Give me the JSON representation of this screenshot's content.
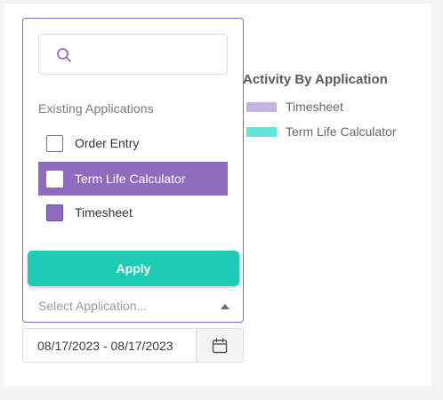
{
  "chart": {
    "title": "Activity By Application",
    "legend": [
      {
        "label": "Timesheet",
        "color": "#c4b3e0"
      },
      {
        "label": "Term Life Calculator",
        "color": "#5fe6d8"
      }
    ]
  },
  "dropdown": {
    "search": {
      "placeholder": "",
      "value": "",
      "icon": "search-icon"
    },
    "section_label": "Existing Applications",
    "options": [
      {
        "label": "Order Entry",
        "checked": false,
        "highlighted": false
      },
      {
        "label": "Term Life Calculator",
        "checked": false,
        "highlighted": true
      },
      {
        "label": "Timesheet",
        "checked": true,
        "highlighted": false
      }
    ],
    "apply_label": "Apply",
    "select_placeholder": "Select Application..."
  },
  "date_range": {
    "value": "08/17/2023 - 08/17/2023",
    "icon": "calendar-icon"
  },
  "colors": {
    "accent": "#8e6bbd",
    "apply": "#1ecbb4"
  }
}
